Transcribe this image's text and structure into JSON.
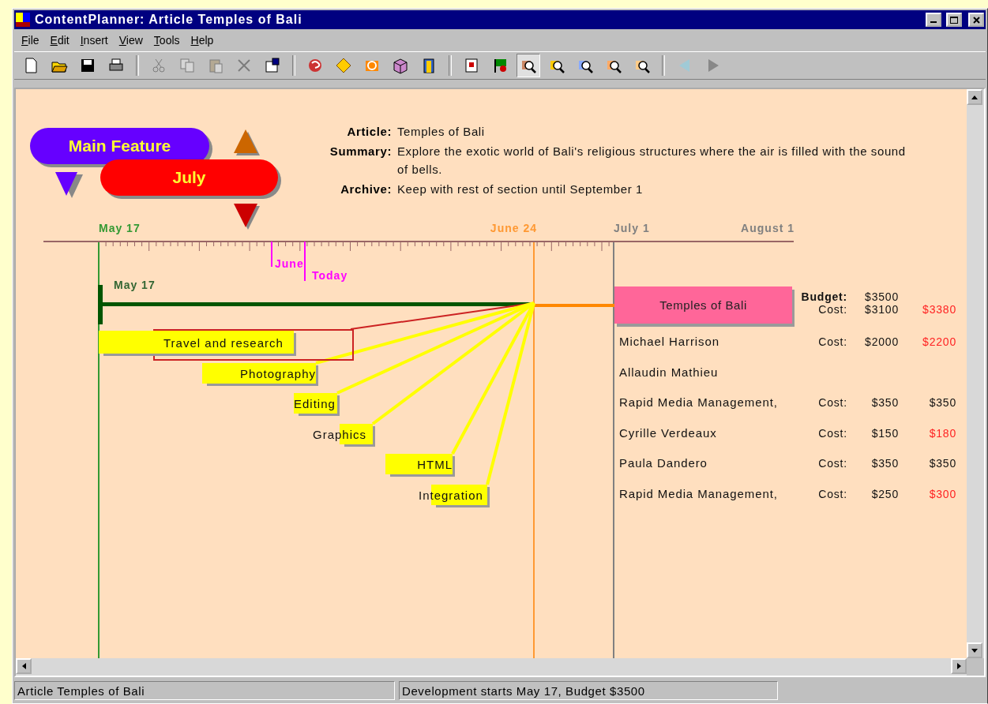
{
  "window": {
    "title": "ContentPlanner: Article Temples of Bali"
  },
  "menu": [
    "File",
    "Edit",
    "Insert",
    "View",
    "Tools",
    "Help"
  ],
  "toolbar": [
    {
      "disabled": false,
      "pressed": false
    },
    {
      "disabled": false,
      "pressed": false
    },
    {
      "disabled": false,
      "pressed": false
    },
    {
      "disabled": false,
      "pressed": false
    },
    {
      "disabled": true,
      "pressed": false
    },
    {
      "disabled": true,
      "pressed": false
    },
    {
      "disabled": true,
      "pressed": false
    },
    {
      "disabled": true,
      "pressed": false
    },
    {
      "disabled": false,
      "pressed": false
    },
    {
      "disabled": false,
      "pressed": false
    },
    {
      "disabled": false,
      "pressed": false
    },
    {
      "disabled": false,
      "pressed": false
    },
    {
      "disabled": false,
      "pressed": false
    },
    {
      "disabled": false,
      "pressed": false
    },
    {
      "disabled": false,
      "pressed": false
    },
    {
      "disabled": false,
      "pressed": false
    },
    {
      "disabled": false,
      "pressed": true
    },
    {
      "disabled": false,
      "pressed": false
    },
    {
      "disabled": false,
      "pressed": false
    },
    {
      "disabled": false,
      "pressed": false
    },
    {
      "disabled": false,
      "pressed": false
    },
    {
      "disabled": true,
      "pressed": false
    },
    {
      "disabled": false,
      "pressed": false
    }
  ],
  "tags": [
    {
      "text": "Main Feature",
      "color": "#6600ff"
    },
    {
      "text": "July",
      "color": "#ff0000"
    }
  ],
  "article": [
    {
      "label": "Article:",
      "value": "Temples of Bali"
    },
    {
      "label": "Summary:",
      "value": "Explore the exotic world of Bali's religious structures where the air is filled with the sound of bells."
    },
    {
      "label": "Archive:",
      "value": "Keep with rest of section until September 1"
    }
  ],
  "timeline": {
    "dates": [
      {
        "text": "May 17",
        "color": "#339933",
        "line": true
      },
      {
        "text": "June 24",
        "color": "#ff9933",
        "line": true
      },
      {
        "text": "July 1",
        "color": "#808080",
        "line": true
      },
      {
        "text": "August 1",
        "color": "#808080",
        "line": false
      }
    ],
    "markers": [
      {
        "text": "June",
        "color": "#ff00ff"
      },
      {
        "text": "Today",
        "color": "#ff00ff"
      }
    ],
    "start_label": "May 17"
  },
  "tasks": [
    {
      "label": "Travel and research",
      "selected": true
    },
    {
      "label": "Photography",
      "selected": false
    },
    {
      "label": "Editing",
      "selected": false
    },
    {
      "label": "Graphics",
      "selected": false
    },
    {
      "label": "HTML",
      "selected": false
    },
    {
      "label": "Integration",
      "selected": false
    }
  ],
  "project": {
    "name": "Temples of Bali",
    "budget_label": "Budget:",
    "budget": "$3500",
    "cost_label": "Cost:",
    "cost": "$3100",
    "estimate": "$3380",
    "over": true
  },
  "assignees": [
    {
      "name": "Michael Harrison",
      "cost_label": "Cost:",
      "cost": "$2000",
      "estimate": "$2200",
      "over": true
    },
    {
      "name": "Allaudin Mathieu"
    },
    {
      "name": "Rapid Media Management,",
      "cost_label": "Cost:",
      "cost": "$350",
      "estimate": "$350",
      "over": false
    },
    {
      "name": "Cyrille Verdeaux",
      "cost_label": "Cost:",
      "cost": "$150",
      "estimate": "$180",
      "over": true
    },
    {
      "name": "Paula Dandero",
      "cost_label": "Cost:",
      "cost": "$350",
      "estimate": "$350",
      "over": false
    },
    {
      "name": "Rapid Media Management,",
      "cost_label": "Cost:",
      "cost": "$250",
      "estimate": "$300",
      "over": true
    }
  ],
  "status_bar": [
    "Article Temples of Bali",
    "Development starts May 17, Budget $3500"
  ]
}
